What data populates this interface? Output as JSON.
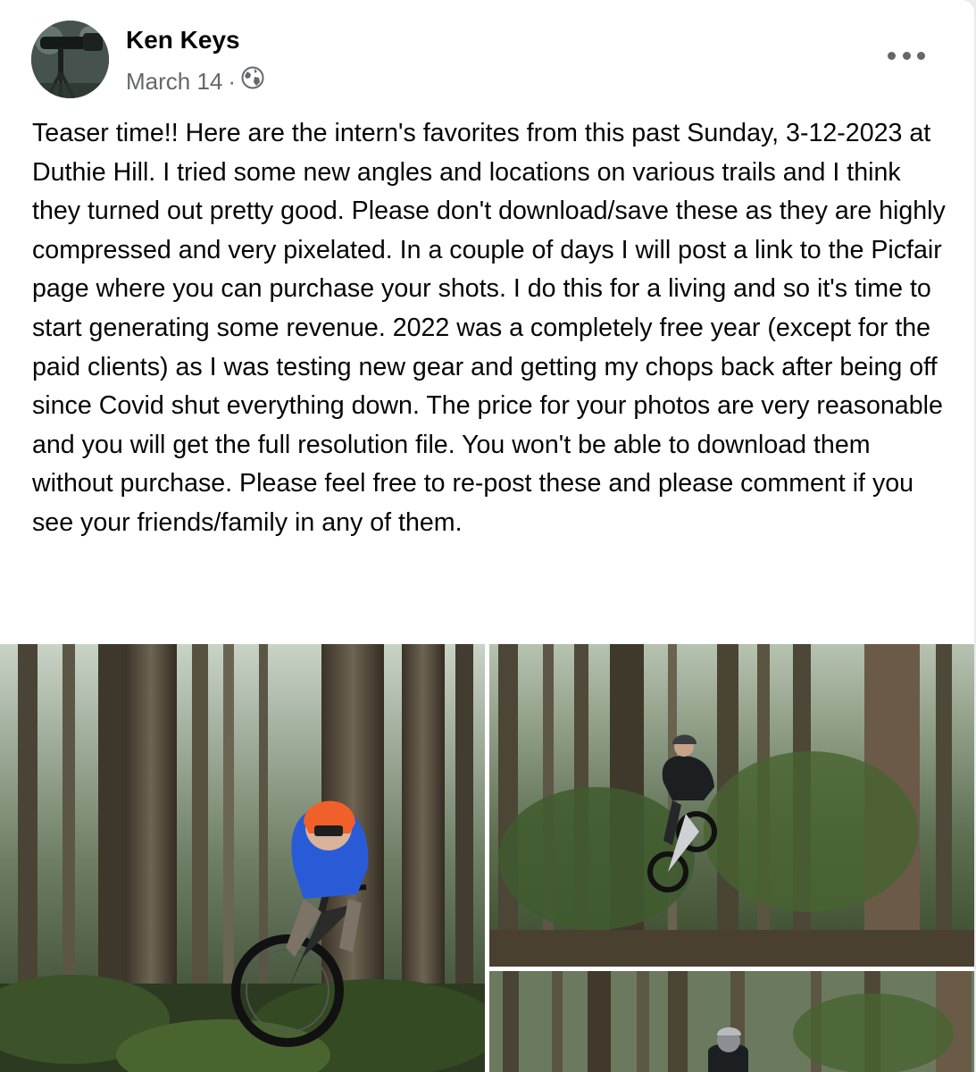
{
  "post": {
    "author": "Ken Keys",
    "date": "March 14",
    "separator": "·",
    "privacy_icon": "globe-icon",
    "more_icon": "more-options-icon",
    "text": "Teaser time!! Here are the intern's favorites from this past Sunday, 3-12-2023 at Duthie Hill. I tried some new angles and locations on various trails and I think they turned out pretty good. Please don't download/save these as they are highly compressed and very pixelated. In a couple of days I will post a link to the Picfair page where you can purchase your shots. I do this for a living and so it's time to start generating some revenue. 2022 was a completely free year (except for the paid clients) as I was testing new gear and getting my chops back after being off since Covid shut everything down. The price for your photos are very reasonable and you will get the full resolution file. You won't be able to download them without purchase. Please feel free to re-post these and please comment if you see your friends/family in any of them."
  },
  "colors": {
    "card_background": "#ffffff",
    "primary_text": "#050505",
    "secondary_text": "#65676b",
    "forest_dark": "#1f2a1d",
    "forest_green": "#3f5a2e",
    "rider_jacket_blue": "#2a5bd7",
    "rider_helmet_orange": "#f0602a"
  }
}
